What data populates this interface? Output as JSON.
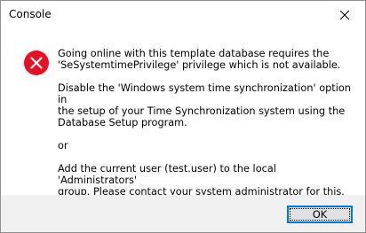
{
  "window": {
    "title": "Console"
  },
  "icons": {
    "close": "close-icon",
    "error": "error-icon"
  },
  "colors": {
    "error_red": "#e81123",
    "button_focus": "#0078d7",
    "footer": "#f0f0f0"
  },
  "message": {
    "paragraphs": [
      "Going online with this template database requires the\n'SeSystemtimePrivilege' privilege which is not available.",
      "Disable the 'Windows system time synchronization' option in\nthe setup of your Time Synchronization system using the\nDatabase Setup program.",
      "or",
      "Add the current user (test.user) to the local 'Administrators'\ngroup. Please contact your system administrator for this."
    ]
  },
  "buttons": {
    "ok_label": "OK"
  }
}
